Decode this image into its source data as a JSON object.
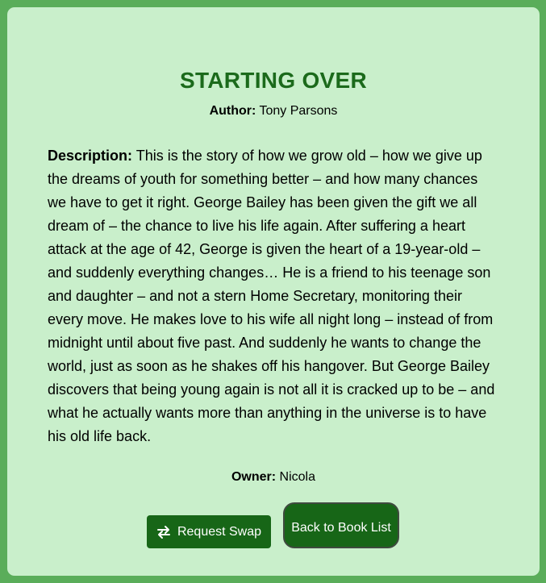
{
  "book": {
    "title": "STARTING OVER",
    "author_label": "Author:",
    "author": "Tony Parsons",
    "description_label": "Description:",
    "description": "This is the story of how we grow old – how we give up the dreams of youth for something better – and how many chances we have to get it right. George Bailey has been given the gift we all dream of – the chance to live his life again. After suffering a heart attack at the age of 42, George is given the heart of a 19-year-old – and suddenly everything changes… He is a friend to his teenage son and daughter – and not a stern Home Secretary, monitoring their every move. He makes love to his wife all night long – instead of from midnight until about five past. And suddenly he wants to change the world, just as soon as he shakes off his hangover. But George Bailey discovers that being young again is not all it is cracked up to be – and what he actually wants more than anything in the universe is to have his old life back.",
    "owner_label": "Owner:",
    "owner": "Nicola"
  },
  "actions": {
    "swap_label": "Request Swap",
    "swap_icon": "swap-arrows-icon",
    "back_label": "Back to Book List"
  },
  "colors": {
    "page_bg": "#5aad5a",
    "card_bg": "#c9efcb",
    "title": "#1b6a1b",
    "button": "#176617"
  }
}
